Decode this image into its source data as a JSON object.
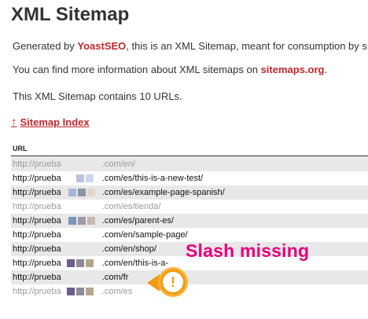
{
  "page": {
    "title": "XML Sitemap",
    "intro": {
      "prefix": "Generated by ",
      "link": "YoastSEO",
      "suffix": ", this is an XML Sitemap, meant for consumption by s"
    },
    "info": {
      "prefix": "You can find more information about XML sitemaps on ",
      "link": "sitemaps.org",
      "suffix": "."
    },
    "count_text": "This XML Sitemap contains 10 URLs.",
    "index_link": "Sitemap Index",
    "table_header": "URL"
  },
  "rows": [
    {
      "prefix": "http://prueba",
      "suffix": ".com/en/",
      "faded": true
    },
    {
      "prefix": "http://prueba",
      "suffix": ".com/es/this-is-a-new-test/",
      "faded": false
    },
    {
      "prefix": "http://prueba",
      "suffix": ".com/es/example-page-spanish/",
      "faded": false
    },
    {
      "prefix": "http://prueba",
      "suffix": ".com/es/tienda/",
      "faded": true
    },
    {
      "prefix": "http://prueba",
      "suffix": ".com/es/parent-es/",
      "faded": false
    },
    {
      "prefix": "http://prueba",
      "suffix": ".com/en/sample-page/",
      "faded": false
    },
    {
      "prefix": "http://prueba",
      "suffix": ".com/en/shop/",
      "faded": false
    },
    {
      "prefix": "http://prueba",
      "suffix": ".com/en/this-is-a-",
      "faded": false
    },
    {
      "prefix": "http://prueba",
      "suffix": ".com/fr",
      "faded": false
    },
    {
      "prefix": "http://prueba",
      "suffix": ".com/es",
      "faded": true
    }
  ],
  "annotation": {
    "label": "Slash missing",
    "badge_symbol": "!"
  },
  "colors": {
    "link": "#c1272d",
    "annotation": "#e4007c",
    "badge": "#f39c12",
    "row_alt": "#e8e8e8"
  }
}
